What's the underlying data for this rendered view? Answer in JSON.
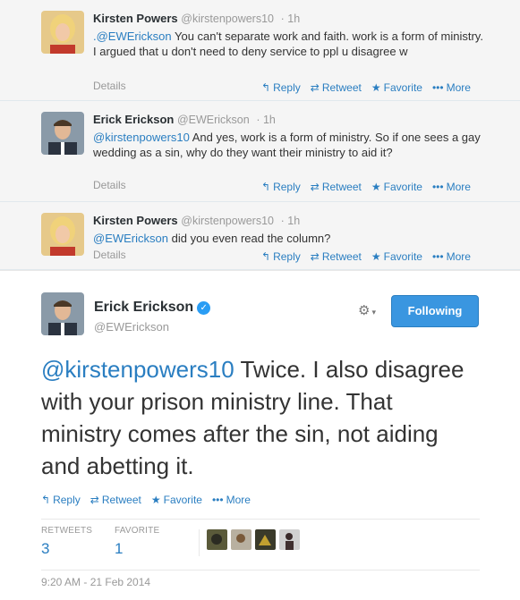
{
  "conversation": [
    {
      "name": "Kirsten Powers",
      "handle": "@kirstenpowers10",
      "time": "1h",
      "mention": ".@EWErickson",
      "text": " You can't separate work and faith. work is a form of ministry.  I argued that u don't need to deny service to ppl u disagree w",
      "details": "Details"
    },
    {
      "name": "Erick Erickson",
      "handle": "@EWErickson",
      "time": "1h",
      "mention": "@kirstenpowers10",
      "text": " And yes, work is a form of ministry.  So if one sees a gay wedding as a sin, why do they want their ministry to aid it?",
      "details": "Details"
    },
    {
      "name": "Kirsten Powers",
      "handle": "@kirstenpowers10",
      "time": "1h",
      "mention": "@EWErickson",
      "text": " did you even read the column?",
      "details": "Details"
    }
  ],
  "actions": {
    "reply": "Reply",
    "retweet": "Retweet",
    "favorite": "Favorite",
    "more": "More"
  },
  "main": {
    "name": "Erick Erickson",
    "handle": "@EWErickson",
    "follow_label": "Following",
    "mention": "@kirstenpowers10",
    "text": " Twice. I also disagree with your prison ministry line. That ministry comes after the sin, not aiding and abetting it.",
    "retweets_label": "RETWEETS",
    "retweets": "3",
    "favorites_label": "FAVORITE",
    "favorites": "1",
    "timestamp": "9:20 AM - 21 Feb 2014"
  },
  "icons": {
    "reply": "reply-arrow-icon",
    "retweet": "retweet-icon",
    "favorite": "star-icon",
    "more": "more-dots-icon",
    "verified": "verified-badge-icon",
    "gear": "gear-icon"
  },
  "colors": {
    "link": "#2a7ec1",
    "follow_button": "#3a96e0",
    "conversation_bg": "#f5f5f5"
  }
}
